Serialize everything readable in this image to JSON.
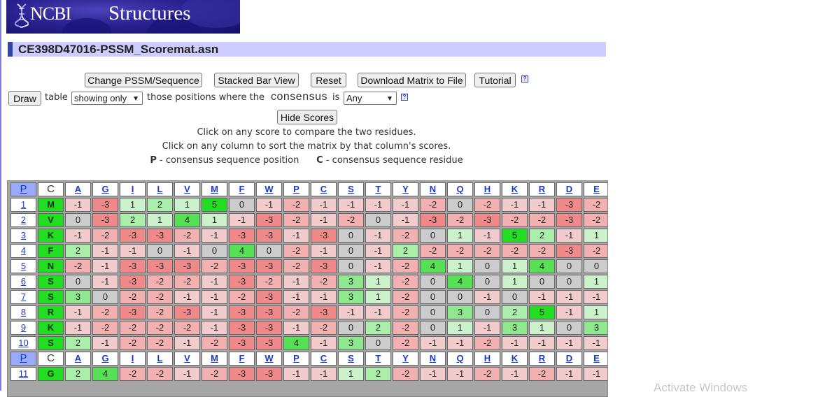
{
  "banner": {
    "logo_text": "NCBI",
    "section_text": "Structures"
  },
  "title": "CE398D47016-PSSM_Scoremat.asn",
  "toolbar": {
    "change": "Change PSSM/Sequence",
    "stacked": "Stacked Bar View",
    "reset": "Reset",
    "download": "Download Matrix to File",
    "tutorial": "Tutorial",
    "help_glyph": "?"
  },
  "filter": {
    "draw": "Draw",
    "table_word": "table",
    "showing_select": "showing only",
    "those_text": "those positions where the",
    "consensus_word": "consensus",
    "is_word": "is",
    "any_select": "Any"
  },
  "hide_scores": "Hide Scores",
  "instructions": {
    "line1": "Click on any score to compare the two residues.",
    "line2": "Click on any column to sort the matrix by that column's scores.",
    "legend_p_key": "P",
    "legend_p_text": "- consensus sequence position",
    "legend_c_key": "C",
    "legend_c_text": "- consensus sequence residue"
  },
  "matrix": {
    "p_header": "P",
    "c_header": "C",
    "columns": [
      "A",
      "G",
      "I",
      "L",
      "V",
      "M",
      "F",
      "W",
      "P",
      "C",
      "S",
      "T",
      "Y",
      "N",
      "Q",
      "H",
      "K",
      "R",
      "D",
      "E"
    ],
    "rows": [
      {
        "pos": "1",
        "res": "M",
        "scores": [
          "-1",
          "-3",
          "1",
          "2",
          "1",
          "5",
          "0",
          "-1",
          "-2",
          "-1",
          "-1",
          "-1",
          "-1",
          "-2",
          "0",
          "-2",
          "-1",
          "-1",
          "-3",
          "-2"
        ]
      },
      {
        "pos": "2",
        "res": "V",
        "scores": [
          "0",
          "-3",
          "2",
          "1",
          "4",
          "1",
          "-1",
          "-3",
          "-2",
          "-1",
          "-2",
          "0",
          "-1",
          "-3",
          "-2",
          "-3",
          "-2",
          "-2",
          "-3",
          "-2"
        ]
      },
      {
        "pos": "3",
        "res": "K",
        "scores": [
          "-1",
          "-2",
          "-3",
          "-3",
          "-2",
          "-1",
          "-3",
          "-3",
          "-1",
          "-3",
          "0",
          "-1",
          "-2",
          "0",
          "1",
          "-1",
          "5",
          "2",
          "-1",
          "1"
        ]
      },
      {
        "pos": "4",
        "res": "F",
        "scores": [
          "2",
          "-1",
          "-1",
          "0",
          "-1",
          "0",
          "4",
          "0",
          "-2",
          "-1",
          "0",
          "-1",
          "2",
          "-2",
          "-2",
          "-2",
          "-2",
          "-2",
          "-3",
          "-2"
        ]
      },
      {
        "pos": "5",
        "res": "N",
        "scores": [
          "-2",
          "-1",
          "-3",
          "-3",
          "-3",
          "-2",
          "-3",
          "-3",
          "-2",
          "-3",
          "0",
          "-1",
          "-2",
          "4",
          "1",
          "0",
          "1",
          "4",
          "0",
          "0"
        ]
      },
      {
        "pos": "6",
        "res": "S",
        "scores": [
          "0",
          "-1",
          "-3",
          "-2",
          "-2",
          "-1",
          "-3",
          "-2",
          "-1",
          "-2",
          "3",
          "1",
          "-2",
          "0",
          "4",
          "0",
          "1",
          "0",
          "0",
          "1"
        ]
      },
      {
        "pos": "7",
        "res": "S",
        "scores": [
          "3",
          "0",
          "-2",
          "-2",
          "-1",
          "-1",
          "-2",
          "-3",
          "-1",
          "-1",
          "3",
          "1",
          "-2",
          "0",
          "0",
          "-1",
          "0",
          "-1",
          "-1",
          "-1"
        ]
      },
      {
        "pos": "8",
        "res": "R",
        "scores": [
          "-1",
          "-2",
          "-3",
          "-2",
          "-3",
          "-1",
          "-3",
          "-3",
          "-2",
          "-3",
          "-1",
          "-1",
          "-2",
          "0",
          "3",
          "0",
          "2",
          "5",
          "-1",
          "1"
        ]
      },
      {
        "pos": "9",
        "res": "K",
        "scores": [
          "-1",
          "-2",
          "-2",
          "-2",
          "-2",
          "-1",
          "-3",
          "-3",
          "-1",
          "-2",
          "0",
          "2",
          "-2",
          "0",
          "1",
          "-1",
          "3",
          "1",
          "0",
          "3"
        ]
      },
      {
        "pos": "10",
        "res": "S",
        "scores": [
          "2",
          "-1",
          "-2",
          "-2",
          "-1",
          "-2",
          "-3",
          "-3",
          "4",
          "-1",
          "3",
          "0",
          "-2",
          "-1",
          "-1",
          "-2",
          "-1",
          "-1",
          "-1",
          "-1"
        ]
      },
      {
        "pos": "11",
        "res": "G",
        "scores": [
          "2",
          "4",
          "-2",
          "-2",
          "-1",
          "-2",
          "-3",
          "-3",
          "-1",
          "-1",
          "1",
          "2",
          "-2",
          "-1",
          "-1",
          "-2",
          "-1",
          "-2",
          "-1",
          "-1"
        ]
      }
    ]
  },
  "colors": {
    "neg3": "#f08a8a",
    "neg2": "#f3b0b0",
    "neg1": "#f2cccc",
    "zero": "#cccccc",
    "pos1": "#ccf2cc",
    "pos2": "#aaeeaa",
    "pos3": "#8ee88e",
    "pos4": "#55e055",
    "pos5": "#22dd22",
    "consensus": "#22dd22",
    "header_p": "#99aaff",
    "title_bar": "#ccccff"
  },
  "watermark": "Activate Windows"
}
